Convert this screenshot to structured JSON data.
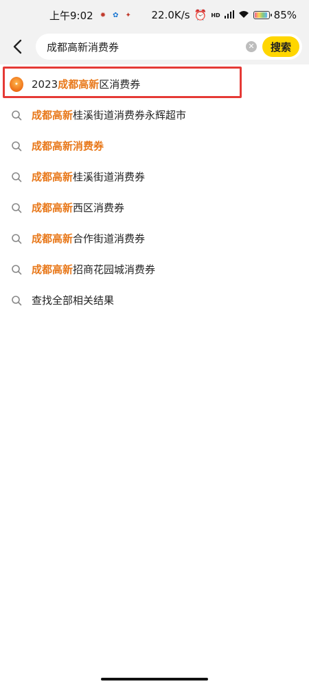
{
  "status_bar": {
    "time": "上午9:02",
    "net_speed": "22.0K/s",
    "signal_label": "HD",
    "battery_percent": "85%",
    "battery_level": 0.85
  },
  "search": {
    "query": "成都高新消费券",
    "button_label": "搜索"
  },
  "suggestions": [
    {
      "prefix": "2023",
      "highlight": "成都高新",
      "suffix": "区消费券",
      "icon": "promo-badge-icon"
    },
    {
      "prefix": "",
      "highlight": "成都高新",
      "suffix": "桂溪街道消费券永辉超市",
      "icon": "search-icon"
    },
    {
      "prefix": "",
      "highlight": "成都高新消费券",
      "suffix": "",
      "icon": "search-icon"
    },
    {
      "prefix": "",
      "highlight": "成都高新",
      "suffix": "桂溪街道消费券",
      "icon": "search-icon"
    },
    {
      "prefix": "",
      "highlight": "成都高新",
      "suffix": "西区消费券",
      "icon": "search-icon"
    },
    {
      "prefix": "",
      "highlight": "成都高新",
      "suffix": "合作街道消费券",
      "icon": "search-icon"
    },
    {
      "prefix": "",
      "highlight": "成都高新",
      "suffix": "招商花园城消费券",
      "icon": "search-icon"
    },
    {
      "prefix": "",
      "highlight": "",
      "suffix": "查找全部相关结果",
      "icon": "search-icon"
    }
  ],
  "colors": {
    "highlight": "#e8781a",
    "accent": "#ffd600",
    "annotation_box": "#e53935"
  }
}
